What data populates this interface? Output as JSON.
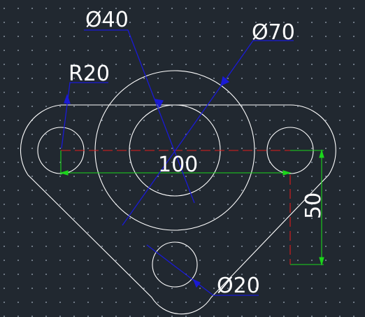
{
  "dimensions": {
    "dia_inner_boss": "Ø40",
    "dia_outer_boss": "Ø70",
    "radius_ear": "R20",
    "dia_bottom_hole": "Ø20",
    "hole_spacing": "100",
    "vertical_offset": "50"
  },
  "colors": {
    "background": "#212830",
    "geometry": "#ffffff",
    "leader": "#1a1ad6",
    "dimension_line": "#1bd61b",
    "centerline": "#e01b1b"
  }
}
